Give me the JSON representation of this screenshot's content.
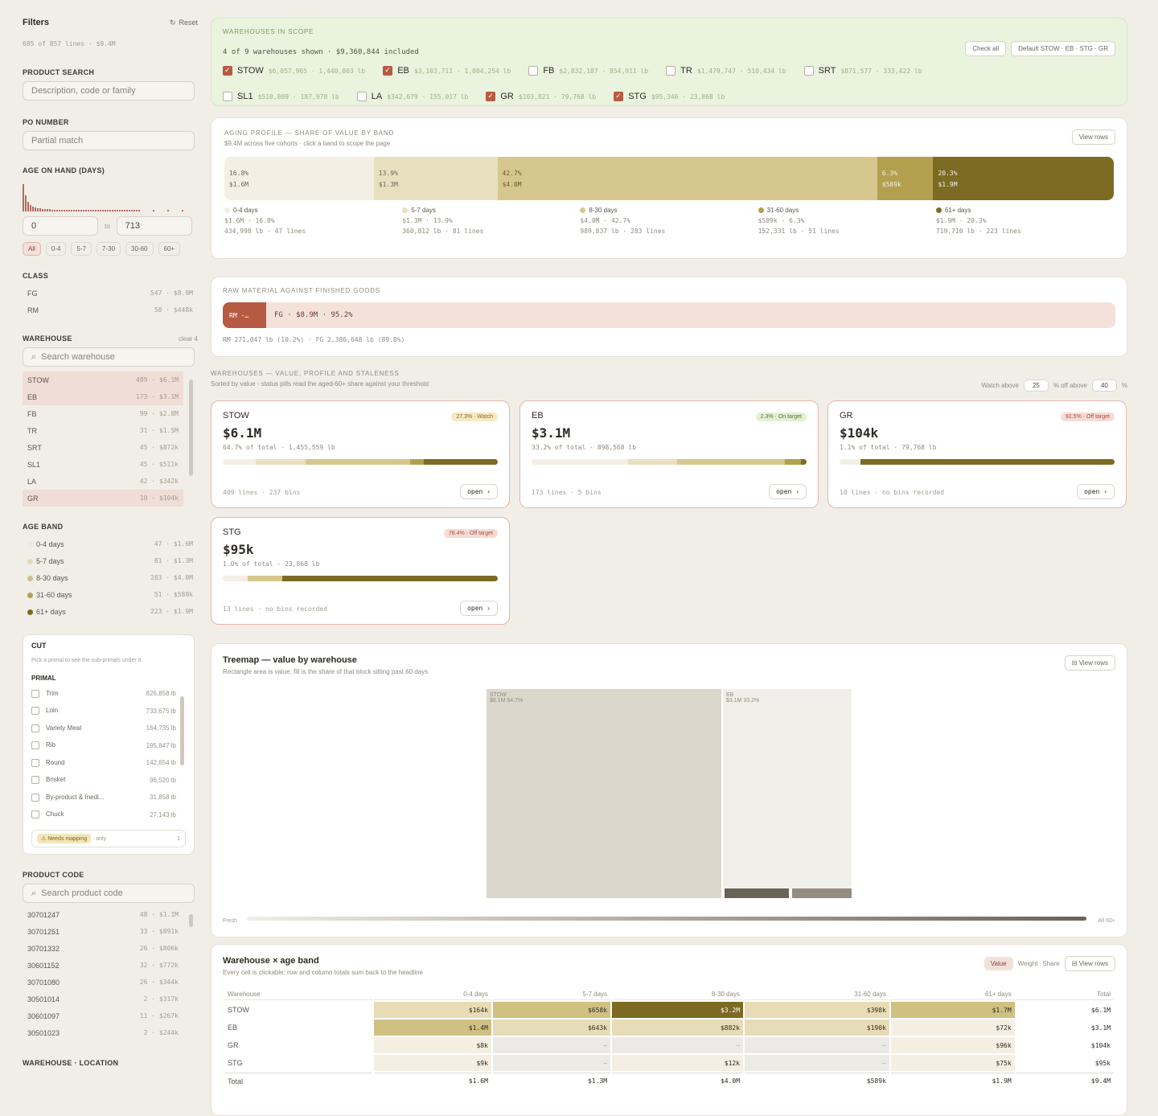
{
  "sidebar": {
    "title": "Filters",
    "reset": "Reset",
    "summary": "685 of 857 lines · $9.4M",
    "product_search": {
      "label": "PRODUCT SEARCH",
      "placeholder": "Description, code or family"
    },
    "po_number": {
      "label": "PO NUMBER",
      "placeholder": "Partial match"
    },
    "age": {
      "label": "AGE ON HAND (DAYS)",
      "min": "0",
      "to": "to",
      "max": "713",
      "chips": [
        "All",
        "0-4",
        "5-7",
        "7-30",
        "30-60",
        "60+"
      ]
    },
    "class": {
      "label": "CLASS",
      "items": [
        {
          "name": "FG",
          "value": "547 · $8.9M"
        },
        {
          "name": "RM",
          "value": "58 · $448k"
        }
      ]
    },
    "warehouse": {
      "label": "WAREHOUSE",
      "clear": "clear 4",
      "search_placeholder": "Search warehouse",
      "items": [
        {
          "name": "STOW",
          "value": "409 · $6.1M",
          "selected": true
        },
        {
          "name": "EB",
          "value": "173 · $3.1M",
          "selected": true
        },
        {
          "name": "FB",
          "value": "99 · $2.8M",
          "selected": false
        },
        {
          "name": "TR",
          "value": "31 · $1.5M",
          "selected": false
        },
        {
          "name": "SRT",
          "value": "45 · $872k",
          "selected": false
        },
        {
          "name": "SL1",
          "value": "45 · $511k",
          "selected": false
        },
        {
          "name": "LA",
          "value": "42 · $342k",
          "selected": false
        },
        {
          "name": "GR",
          "value": "10 · $104k",
          "selected": true
        }
      ]
    },
    "age_band": {
      "label": "AGE BAND",
      "items": [
        {
          "name": "0-4 days",
          "value": "47 · $1.6M",
          "color": "#efe9da"
        },
        {
          "name": "5-7 days",
          "value": "81 · $1.3M",
          "color": "#e5dab6"
        },
        {
          "name": "8-30 days",
          "value": "283 · $4.0M",
          "color": "#cfc08a"
        },
        {
          "name": "31-60 days",
          "value": "51 · $589k",
          "color": "#b5a050"
        },
        {
          "name": "61+ days",
          "value": "223 · $1.9M",
          "color": "#7c6a22"
        }
      ]
    },
    "cut": {
      "title": "CUT",
      "hint": "Pick a primal to see the sub-primals under it.",
      "primal": "PRIMAL",
      "items": [
        {
          "name": "Trim",
          "value": "826,858 lb"
        },
        {
          "name": "Loin",
          "value": "733,675 lb"
        },
        {
          "name": "Variety Meat",
          "value": "164,735 lb"
        },
        {
          "name": "Rib",
          "value": "195,847 lb"
        },
        {
          "name": "Round",
          "value": "142,654 lb"
        },
        {
          "name": "Brisket",
          "value": "96,520 lb"
        },
        {
          "name": "By-product & Inedi...",
          "value": "31,858 lb"
        },
        {
          "name": "Chuck",
          "value": "27,143 lb"
        }
      ],
      "needs_tag": "⚠ Needs mapping",
      "only": "only",
      "needs_count": "1"
    },
    "product_code": {
      "label": "PRODUCT CODE",
      "search_placeholder": "Search product code",
      "items": [
        {
          "name": "30701247",
          "value": "48 · $1.1M"
        },
        {
          "name": "30701251",
          "value": "33 · $891k"
        },
        {
          "name": "30701332",
          "value": "26 · $806k"
        },
        {
          "name": "30601152",
          "value": "32 · $772k"
        },
        {
          "name": "30701080",
          "value": "26 · $344k"
        },
        {
          "name": "30501014",
          "value": "2 · $317k"
        },
        {
          "name": "30601097",
          "value": "11 · $267k"
        },
        {
          "name": "30501023",
          "value": "2 · $244k"
        }
      ]
    },
    "warehouse_location": {
      "label": "WAREHOUSE · LOCATION"
    }
  },
  "scope": {
    "label": "WAREHOUSES IN SCOPE",
    "summary": "4 of 9 warehouses shown · $9,360,844 included",
    "check_all": "Check all",
    "default": "Default STOW · EB · STG · GR",
    "warehouses": [
      {
        "name": "STOW",
        "detail": "$6,057,965 · 1,440,003 lb",
        "checked": true
      },
      {
        "name": "EB",
        "detail": "$3,103,711 · 1,004,254 lb",
        "checked": true
      },
      {
        "name": "FB",
        "detail": "$2,832,187 · 854,911 lb",
        "checked": false
      },
      {
        "name": "TR",
        "detail": "$1,479,747 · 510,434 lb",
        "checked": false
      },
      {
        "name": "SRT",
        "detail": "$871,577 · 333,422 lb",
        "checked": false
      },
      {
        "name": "SL1",
        "detail": "$510,809 · 187,978 lb",
        "checked": false
      },
      {
        "name": "LA",
        "detail": "$342,079 · 155,017 lb",
        "checked": false
      },
      {
        "name": "GR",
        "detail": "$103,821 · 79,768 lb",
        "checked": true
      },
      {
        "name": "STG",
        "detail": "$95,346 · 23,868 lb",
        "checked": true
      }
    ]
  },
  "aging": {
    "label": "AGING PROFILE — SHARE OF VALUE BY BAND",
    "sub": "$9.4M across five cohorts · click a band to scope the page",
    "view_rows": "View rows",
    "bands": [
      {
        "pct": "16.8%",
        "val": "$1.6M",
        "share": 16.8,
        "color": "#f3efe4",
        "text": "#6b655c",
        "name": "0-4 days",
        "line1": "$1.6M · 16.8%",
        "line2": "434,998 lb · 47 lines"
      },
      {
        "pct": "13.9%",
        "val": "$1.3M",
        "share": 13.9,
        "color": "#e8dfbf",
        "text": "#6b655c",
        "name": "5-7 days",
        "line1": "$1.3M · 13.9%",
        "line2": "360,812 lb · 81 lines"
      },
      {
        "pct": "42.7%",
        "val": "$4.0M",
        "share": 42.7,
        "color": "#d6c78f",
        "text": "#6b5d2a",
        "name": "8-30 days",
        "line1": "$4.0M · 42.7%",
        "line2": "989,837 lb · 283 lines"
      },
      {
        "pct": "6.3%",
        "val": "$589k",
        "share": 6.3,
        "color": "#b2a04e",
        "text": "#f4efe0",
        "name": "31-60 days",
        "line1": "$589k · 6.3%",
        "line2": "152,331 lb · 51 lines"
      },
      {
        "pct": "20.3%",
        "val": "$1.9M",
        "share": 20.3,
        "color": "#7d6b23",
        "text": "#f4efe0",
        "name": "61+ days",
        "line1": "$1.9M · 20.3%",
        "line2": "719,710 lb · 223 lines"
      }
    ]
  },
  "rmfg": {
    "label": "RAW MATERIAL AGAINST FINISHED GOODS",
    "rm": "RM ·…",
    "fg": "FG · $8.9M · 95.2%",
    "foot": "RM 271,047 lb (10.2%) · FG 2,386,648 lb (89.8%)",
    "rm_share": 4.8
  },
  "wh_section": {
    "label": "WAREHOUSES — VALUE, PROFILE AND STALENESS",
    "sub": "Sorted by value · status pills read the aged-60+ share against your threshold",
    "watch_above": "Watch above",
    "watch_val": "25",
    "off_above": "% off above",
    "off_val": "40",
    "pct": "%"
  },
  "wh_cards": [
    {
      "name": "STOW",
      "value": "$6.1M",
      "meta": "64.7% of total · 1,455,559 lb",
      "pill": "27.3% · Watch",
      "status": "watch",
      "foot": "409 lines · 237 bins",
      "open": "open ›",
      "bands": [
        12,
        18,
        38,
        5,
        27
      ]
    },
    {
      "name": "EB",
      "value": "$3.1M",
      "meta": "33.2% of total · 898,568 lb",
      "pill": "2.3% · On target",
      "status": "ok",
      "foot": "173 lines · 5 bins",
      "open": "open ›",
      "bands": [
        35,
        18,
        39,
        6,
        2
      ]
    },
    {
      "name": "GR",
      "value": "$104k",
      "meta": "1.1% of total · 79,768 lb",
      "pill": "92.5% · Off target",
      "status": "off",
      "foot": "10 lines · no bins recorded",
      "open": "open ›",
      "bands": [
        7.5,
        0,
        0,
        0,
        92.5
      ]
    },
    {
      "name": "STG",
      "value": "$95k",
      "meta": "1.0% of total · 23,868 lb",
      "pill": "78.4% · Off target",
      "status": "off",
      "foot": "13 lines · no bins recorded",
      "open": "open ›",
      "bands": [
        9,
        0,
        12.6,
        0,
        78.4
      ]
    }
  ],
  "treemap": {
    "title": "Treemap — value by warehouse",
    "sub": "Rectangle area is value; fill is the share of that block sitting past 60 days",
    "view_rows": "View rows",
    "blocks": [
      {
        "name": "STOW",
        "label": "$6.1M 64.7%",
        "share": 64.7
      },
      {
        "name": "EB",
        "label": "$3.1M 33.2%",
        "share": 33.2
      }
    ],
    "fresh": "Fresh",
    "aged": "All 60+"
  },
  "matrix": {
    "title": "Warehouse × age band",
    "sub": "Every cell is clickable; row and column totals sum back to the headline",
    "toggles": [
      "Value",
      "Weight",
      "Share"
    ],
    "view_rows": "View rows",
    "columns": [
      "Warehouse",
      "0-4 days",
      "5-7 days",
      "8-30 days",
      "31-60 days",
      "61+ days",
      "Total"
    ],
    "rows": [
      {
        "name": "STOW",
        "cells": [
          "$164k",
          "$658k",
          "$3.2M",
          "$398k",
          "$1.7M"
        ],
        "total": "$6.1M",
        "levels": [
          1,
          2,
          4,
          1,
          2
        ]
      },
      {
        "name": "EB",
        "cells": [
          "$1.4M",
          "$643k",
          "$882k",
          "$190k",
          "$72k"
        ],
        "total": "$3.1M",
        "levels": [
          2,
          1,
          1,
          1,
          0
        ]
      },
      {
        "name": "GR",
        "cells": [
          "$8k",
          "–",
          "–",
          "–",
          "$96k"
        ],
        "total": "$104k",
        "levels": [
          0,
          -1,
          -1,
          -1,
          0
        ]
      },
      {
        "name": "STG",
        "cells": [
          "$9k",
          "–",
          "$12k",
          "–",
          "$75k"
        ],
        "total": "$95k",
        "levels": [
          0,
          -1,
          0,
          -1,
          0
        ]
      }
    ],
    "totals": {
      "name": "Total",
      "cells": [
        "$1.6M",
        "$1.3M",
        "$4.0M",
        "$589k",
        "$1.9M"
      ],
      "total": "$9.4M"
    }
  }
}
